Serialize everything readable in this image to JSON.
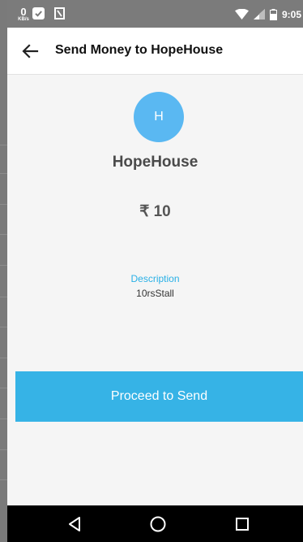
{
  "status_bar": {
    "net_speed": "0",
    "net_unit": "KB/s",
    "time": "9:05"
  },
  "app_bar": {
    "title": "Send Money to HopeHouse"
  },
  "payee": {
    "initial": "H",
    "name": "HopeHouse"
  },
  "amount": {
    "text": "₹ 10"
  },
  "description": {
    "label": "Description",
    "value": "10rsStall"
  },
  "actions": {
    "proceed_label": "Proceed to Send"
  },
  "colors": {
    "accent": "#36b3e6",
    "avatar": "#5ab8f2",
    "label_blue": "#29b0e6"
  },
  "icons": {
    "back": "arrow-back-icon",
    "nav_back": "triangle-back-icon",
    "nav_home": "circle-home-icon",
    "nav_recent": "square-recent-icon"
  }
}
